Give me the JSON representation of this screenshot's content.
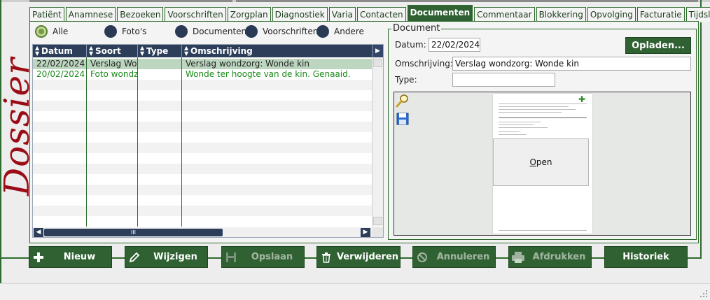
{
  "app": {
    "side_title": "Dossier",
    "accent": "#2f6132",
    "side_title_color": "#9b0d16"
  },
  "tabs": [
    {
      "label": "Patiënt",
      "active": false
    },
    {
      "label": "Anamnese",
      "active": false
    },
    {
      "label": "Bezoeken",
      "active": false
    },
    {
      "label": "Voorschriften",
      "active": false
    },
    {
      "label": "Zorgplan",
      "active": false
    },
    {
      "label": "Diagnostiek",
      "active": false
    },
    {
      "label": "Varia",
      "active": false
    },
    {
      "label": "Contacten",
      "active": false
    },
    {
      "label": "Documenten",
      "active": true
    },
    {
      "label": "Commentaar",
      "active": false
    },
    {
      "label": "Blokkering",
      "active": false
    },
    {
      "label": "Opvolging",
      "active": false
    },
    {
      "label": "Facturatie",
      "active": false
    },
    {
      "label": "Tijdslijn",
      "active": false
    }
  ],
  "filters": {
    "selected": "Alle",
    "options": [
      "Alle",
      "Foto's",
      "Documenten",
      "Voorschriften",
      "Andere"
    ]
  },
  "grid": {
    "columns": [
      "Datum",
      "Soort",
      "Type",
      "Omschrijving"
    ],
    "rows": [
      {
        "datum": "22/02/2024",
        "soort": "Verslag Wondzorg",
        "type": "",
        "omschrijving": "Verslag wondzorg: Wonde kin",
        "selected": true
      },
      {
        "datum": "20/02/2024",
        "soort": "Foto wondzorg",
        "type": "",
        "omschrijving": "Wonde ter hoogte van de kin. Genaaid.",
        "selected": false
      }
    ],
    "hscroll_thumb_label": "III"
  },
  "document": {
    "legend": "Document",
    "datum_label": "Datum:",
    "datum_value": "22/02/2024",
    "omschrijving_label": "Omschrijving:",
    "omschrijving_value": "Verslag wondzorg: Wonde kin",
    "type_label": "Type:",
    "type_value": "",
    "upload_label": "Opladen...",
    "open_label_underlined": "O",
    "open_label_rest": "pen",
    "preview_icons": [
      "magnifier-icon",
      "floppy-disk-icon"
    ]
  },
  "actions": [
    {
      "label": "Nieuw",
      "icon": "plus-icon",
      "enabled": true
    },
    {
      "label": "Wijzigen",
      "icon": "pencil-icon",
      "enabled": true
    },
    {
      "label": "Opslaan",
      "icon": "floppy-disk-icon",
      "enabled": false
    },
    {
      "label": "Verwijderen",
      "icon": "trash-icon",
      "enabled": true
    },
    {
      "label": "Annuleren",
      "icon": "cancel-icon",
      "enabled": false
    },
    {
      "label": "Afdrukken",
      "icon": "printer-icon",
      "enabled": false
    },
    {
      "label": "Historiek",
      "icon": "",
      "enabled": true
    }
  ]
}
